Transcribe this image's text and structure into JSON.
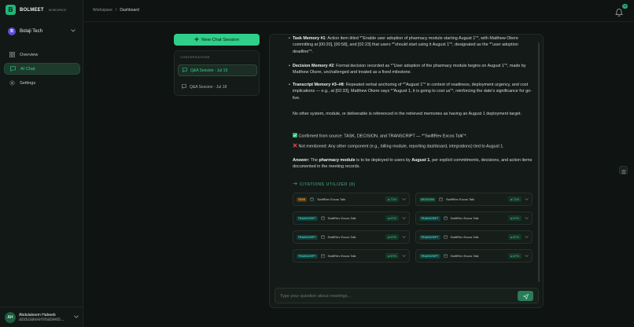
{
  "brand": {
    "name": "BOLMEET",
    "sub": "WORKSPACE",
    "logo_letter": "B"
  },
  "org": {
    "initial": "B",
    "name": "Bolaji Tech"
  },
  "nav": [
    {
      "label": "Overview",
      "icon": "grid-icon"
    },
    {
      "label": "AI Chat",
      "icon": "chat-icon",
      "active": true
    },
    {
      "label": "Settings",
      "icon": "gear-icon"
    }
  ],
  "user": {
    "initials": "AH",
    "name": "Abdulakeem Habeeb",
    "email": "abdulakeemhabeeb..."
  },
  "breadcrumb": {
    "root": "Workspace",
    "sep": "/",
    "current": "Dashboard"
  },
  "notifications": {
    "count": "99"
  },
  "sessions": {
    "new_label": "New Chat Session",
    "header": "CONVERSATIONS",
    "items": [
      {
        "label": "Q&A Session - Jul 19",
        "active": true
      },
      {
        "label": "Q&A Session - Jul 18",
        "active": false
      }
    ]
  },
  "message": {
    "b1_title": "Task Memory #1",
    "b1_text": ": Action item titled *\"Enable user adoption of pharmacy module starting August 1\"*, with Matthew Okere committing at [00:20], [00:58], and [02:23] that users *\"should start using it August 1\"*, designated as the *\"user adoption deadline\"*.",
    "b2_title": "Decision Memory #2",
    "b2_text": ": Formal decision recorded as *\"User adoption of the pharmacy module begins on August 1\"*, made by Matthew Okere, unchallenged and treated as a fixed milestone.",
    "b3_title": "Transcript Memory #3–#8",
    "b3_text": ": Repeated verbal anchoring of *\"August 1\"* in context of readiness, deployment urgency, and cost implications — e.g., at [02:33], Matthew Okere says *\"August 1, it is going to cost us\"*, reinforcing the date's significance for go-live.",
    "p1": "No other system, module, or deliverable is referenced in the retrieved memories as having an August 1 deployment target.",
    "confirmed": "Confirmed from source: TASK, DECISION, and TRANSCRIPT — *\"SwiftRev Excos Talk\"*.",
    "not_mentioned": "Not mentioned: Any other component (e.g., billing module, reporting dashboard, integrations) tied to August 1.",
    "answer_label": "Answer:",
    "answer_a": " The ",
    "answer_b": "pharmacy module",
    "answer_c": " is to be deployed to users by ",
    "answer_d": "August 1",
    "answer_e": ", per explicit commitments, decisions, and action items documented in the meeting records."
  },
  "citations": {
    "header": "CITATIONS UTILIZED (8)",
    "items": [
      {
        "tag": "TASK",
        "kind": "task",
        "title": "SwiftRev Excos Talk",
        "pct": "71%"
      },
      {
        "tag": "DECISION",
        "kind": "decision",
        "title": "SwiftRev Excos Talk",
        "pct": "71%"
      },
      {
        "tag": "TRANSCRIPT",
        "kind": "transcript",
        "title": "SwiftRev Excos Talk",
        "pct": "67%"
      },
      {
        "tag": "TRANSCRIPT",
        "kind": "transcript",
        "title": "SwiftRev Excos Talk",
        "pct": "67%"
      },
      {
        "tag": "TRANSCRIPT",
        "kind": "transcript",
        "title": "SwiftRev Excos Talk",
        "pct": "67%"
      },
      {
        "tag": "TRANSCRIPT",
        "kind": "transcript",
        "title": "SwiftRev Excos Talk",
        "pct": "67%"
      },
      {
        "tag": "TRANSCRIPT",
        "kind": "transcript",
        "title": "SwiftRev Excos Talk",
        "pct": "67%"
      },
      {
        "tag": "TRANSCRIPT",
        "kind": "transcript",
        "title": "SwiftRev Excos Talk",
        "pct": "67%"
      }
    ]
  },
  "input": {
    "placeholder": "Type your question about meetings..."
  },
  "colors": {
    "accent": "#2fcf8a",
    "bg": "#0f1311",
    "panel": "#131a17"
  }
}
